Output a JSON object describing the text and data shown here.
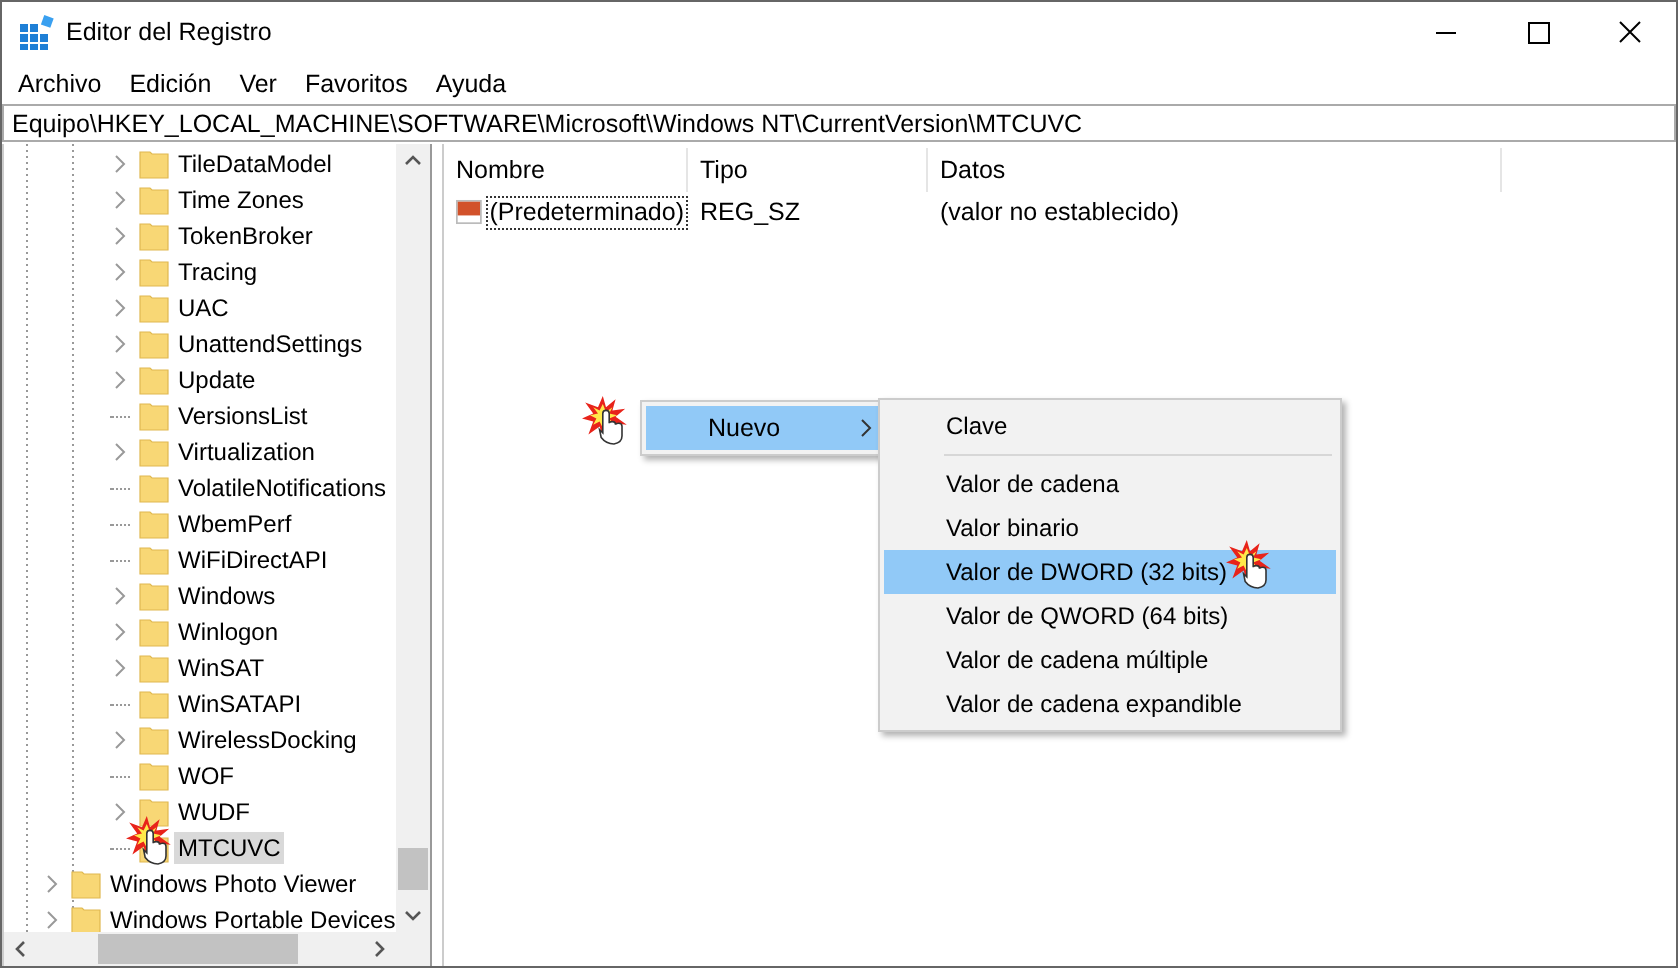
{
  "window": {
    "title": "Editor del Registro"
  },
  "menu": [
    "Archivo",
    "Edición",
    "Ver",
    "Favoritos",
    "Ayuda"
  ],
  "address": "Equipo\\HKEY_LOCAL_MACHINE\\SOFTWARE\\Microsoft\\Windows NT\\CurrentVersion\\MTCUVC",
  "tree": {
    "deeper_items": [
      {
        "label": "TileDataModel",
        "expandable": true,
        "selected": false
      },
      {
        "label": "Time Zones",
        "expandable": true,
        "selected": false
      },
      {
        "label": "TokenBroker",
        "expandable": true,
        "selected": false
      },
      {
        "label": "Tracing",
        "expandable": true,
        "selected": false
      },
      {
        "label": "UAC",
        "expandable": true,
        "selected": false
      },
      {
        "label": "UnattendSettings",
        "expandable": true,
        "selected": false
      },
      {
        "label": "Update",
        "expandable": true,
        "selected": false
      },
      {
        "label": "VersionsList",
        "expandable": false,
        "selected": false
      },
      {
        "label": "Virtualization",
        "expandable": true,
        "selected": false
      },
      {
        "label": "VolatileNotifications",
        "expandable": false,
        "selected": false
      },
      {
        "label": "WbemPerf",
        "expandable": false,
        "selected": false
      },
      {
        "label": "WiFiDirectAPI",
        "expandable": false,
        "selected": false
      },
      {
        "label": "Windows",
        "expandable": true,
        "selected": false
      },
      {
        "label": "Winlogon",
        "expandable": true,
        "selected": false
      },
      {
        "label": "WinSAT",
        "expandable": true,
        "selected": false
      },
      {
        "label": "WinSATAPI",
        "expandable": false,
        "selected": false
      },
      {
        "label": "WirelessDocking",
        "expandable": true,
        "selected": false
      },
      {
        "label": "WOF",
        "expandable": false,
        "selected": false
      },
      {
        "label": "WUDF",
        "expandable": true,
        "selected": false
      },
      {
        "label": "MTCUVC",
        "expandable": false,
        "selected": true
      }
    ],
    "items": [
      {
        "label": "Windows Photo Viewer",
        "expandable": true,
        "selected": false
      },
      {
        "label": "Windows Portable Devices",
        "expandable": true,
        "selected": false
      }
    ]
  },
  "list": {
    "columns": [
      "Nombre",
      "Tipo",
      "Datos"
    ],
    "rows": [
      {
        "name": "(Predeterminado)",
        "type": "REG_SZ",
        "data": "(valor no establecido)"
      }
    ]
  },
  "context_menu": {
    "items": [
      {
        "label": "Nuevo",
        "selected": true
      }
    ]
  },
  "submenu": {
    "items": [
      {
        "label": "Clave",
        "selected": false,
        "separator_after": true
      },
      {
        "label": "Valor de cadena",
        "selected": false
      },
      {
        "label": "Valor binario",
        "selected": false
      },
      {
        "label": "Valor de DWORD (32 bits)",
        "selected": true
      },
      {
        "label": "Valor de QWORD (64 bits)",
        "selected": false
      },
      {
        "label": "Valor de cadena múltiple",
        "selected": false
      },
      {
        "label": "Valor de cadena expandible",
        "selected": false
      }
    ]
  }
}
